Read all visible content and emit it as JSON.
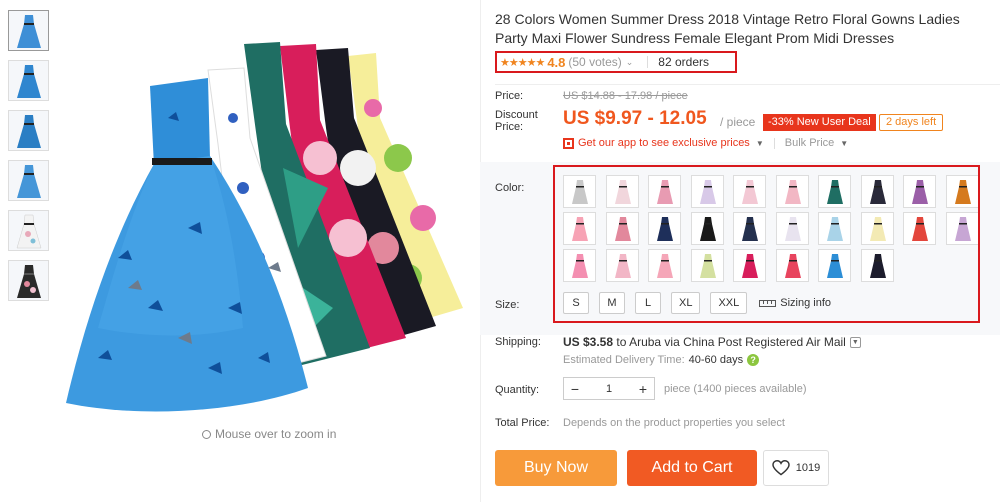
{
  "product": {
    "title": "28 Colors Women Summer Dress 2018 Vintage Retro Floral Gowns Ladies Party Maxi Flower Sundress Female Elegant Prom Midi Dresses",
    "stars": "★★★★★",
    "rating": "4.8",
    "votes": "(50 votes)",
    "orders": "82 orders"
  },
  "gallery": {
    "thumbnails": [
      {
        "name": "thumb-1",
        "color": "#3e8fd6"
      },
      {
        "name": "thumb-2",
        "color": "#2f86cf"
      },
      {
        "name": "thumb-3",
        "color": "#2a7ec4"
      },
      {
        "name": "thumb-4",
        "color": "#4596d8"
      },
      {
        "name": "thumb-5",
        "color": "#e8a9b9"
      },
      {
        "name": "thumb-6",
        "color": "#2a2a2a"
      }
    ],
    "zoom_hint": "Mouse over to zoom in"
  },
  "price": {
    "label": "Price:",
    "original": "US $14.88 - 17.98 / piece",
    "discount_label": "Discount Price:",
    "discount": "US $9.97 - 12.05",
    "unit": "/ piece",
    "deal_badge": "-33% New User Deal",
    "days_left": "2 days left",
    "app_link": "Get our app to see exclusive prices",
    "bulk_price": "Bulk Price"
  },
  "options": {
    "color_label": "Color:",
    "swatch_colors": [
      "#c8c8c8",
      "#f1d6dc",
      "#e89bb2",
      "#d8c9e8",
      "#f3c8d4",
      "#f2b7c4",
      "#1f6e63",
      "#2a2a3a",
      "#9b5fa8",
      "#d57a1e",
      "#f7a3b5",
      "#e2889c",
      "#1e2f5a",
      "#1a1a1a",
      "#24304e",
      "#e8e3ef",
      "#a9d3e8",
      "#f3eab4",
      "#e3463c",
      "#c7a6d4",
      "#f48fb1",
      "#f2b6c6",
      "#f5a6b8",
      "#d4e0a0",
      "#d81e5b",
      "#e8445e",
      "#2c8ed6",
      "#1c1c2c"
    ],
    "size_label": "Size:",
    "sizes": [
      "S",
      "M",
      "L",
      "XL",
      "XXL"
    ],
    "sizing_info": "Sizing info"
  },
  "shipping": {
    "label": "Shipping:",
    "price": "US $3.58",
    "text": "to Aruba via China Post Registered Air Mail",
    "est_label": "Estimated Delivery Time:",
    "est_days": "40-60 days"
  },
  "quantity": {
    "label": "Quantity:",
    "value": "1",
    "note": "piece (1400 pieces available)"
  },
  "total": {
    "label": "Total Price:",
    "note": "Depends on the product properties you select"
  },
  "actions": {
    "buy_now": "Buy Now",
    "add_to_cart": "Add to Cart",
    "wishlist_count": "1019"
  },
  "colors": {
    "accent_red": "#d9191d",
    "price_orange": "#f0571e",
    "buy_now": "#f79a3a",
    "add_to_cart": "#f15a23"
  }
}
